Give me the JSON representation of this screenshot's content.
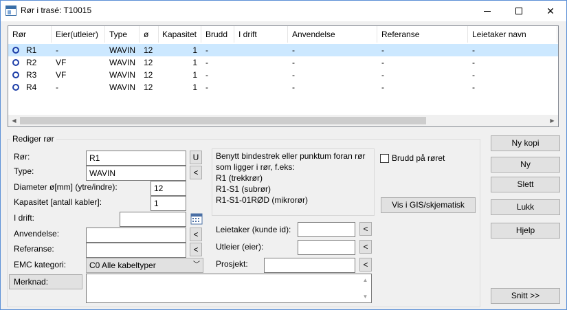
{
  "window": {
    "title": "Rør i trasé: T10015"
  },
  "table": {
    "columns": [
      "Rør",
      "Eier(utleier)",
      "Type",
      "ø",
      "Kapasitet",
      "Brudd",
      "I drift",
      "Anvendelse",
      "Referanse",
      "Leietaker navn"
    ],
    "rows": [
      {
        "ror": "R1",
        "eier": "-",
        "type": "WAVIN",
        "diameter": "12",
        "kapasitet": "1",
        "brudd": "-",
        "idrift": "",
        "anvendelse": "-",
        "referanse": "-",
        "leietaker": "-",
        "selected": true
      },
      {
        "ror": "R2",
        "eier": "VF",
        "type": "WAVIN",
        "diameter": "12",
        "kapasitet": "1",
        "brudd": "-",
        "idrift": "",
        "anvendelse": "-",
        "referanse": "-",
        "leietaker": "-",
        "selected": false
      },
      {
        "ror": "R3",
        "eier": "VF",
        "type": "WAVIN",
        "diameter": "12",
        "kapasitet": "1",
        "brudd": "-",
        "idrift": "",
        "anvendelse": "-",
        "referanse": "-",
        "leietaker": "-",
        "selected": false
      },
      {
        "ror": "R4",
        "eier": "-",
        "type": "WAVIN",
        "diameter": "12",
        "kapasitet": "1",
        "brudd": "-",
        "idrift": "",
        "anvendelse": "-",
        "referanse": "-",
        "leietaker": "-",
        "selected": false
      }
    ]
  },
  "edit": {
    "group_title": "Rediger rør",
    "ror_label": "Rør:",
    "ror_value": "R1",
    "u_button": "U",
    "type_label": "Type:",
    "type_value": "WAVIN",
    "lookup_glyph": "<",
    "diameter_label": "Diameter ø[mm] (ytre/indre):",
    "diameter_value": "12",
    "kapasitet_label": "Kapasitet [antall kabler]:",
    "kapasitet_value": "1",
    "idrift_label": "I drift:",
    "idrift_value": "",
    "anvendelse_label": "Anvendelse:",
    "anvendelse_value": "",
    "referanse_label": "Referanse:",
    "referanse_value": "",
    "emc_label": "EMC kategori:",
    "emc_value": "C0 Alle kabeltyper",
    "merknad_label": "Merknad:",
    "merknad_value": "",
    "help_text": "Benytt bindestrek eller punktum foran rør som ligger i rør, f.eks:\nR1 (trekkrør)\nR1-S1 (subrør)\nR1-S1-01RØD (mikrorør)",
    "brudd_label": "Brudd på røret",
    "brudd_checked": false,
    "gis_button": "Vis i GIS/skjematisk",
    "leietaker_label": "Leietaker (kunde id):",
    "leietaker_value": "",
    "utleier_label": "Utleier (eier):",
    "utleier_value": "",
    "prosjekt_label": "Prosjekt:",
    "prosjekt_value": ""
  },
  "side_buttons": {
    "ny_kopi": "Ny kopi",
    "ny": "Ny",
    "slett": "Slett",
    "lukk": "Lukk",
    "hjelp": "Hjelp",
    "snitt": "Snitt >>"
  },
  "colors": {
    "selection": "#cce8ff",
    "accent": "#1e3fa8"
  }
}
